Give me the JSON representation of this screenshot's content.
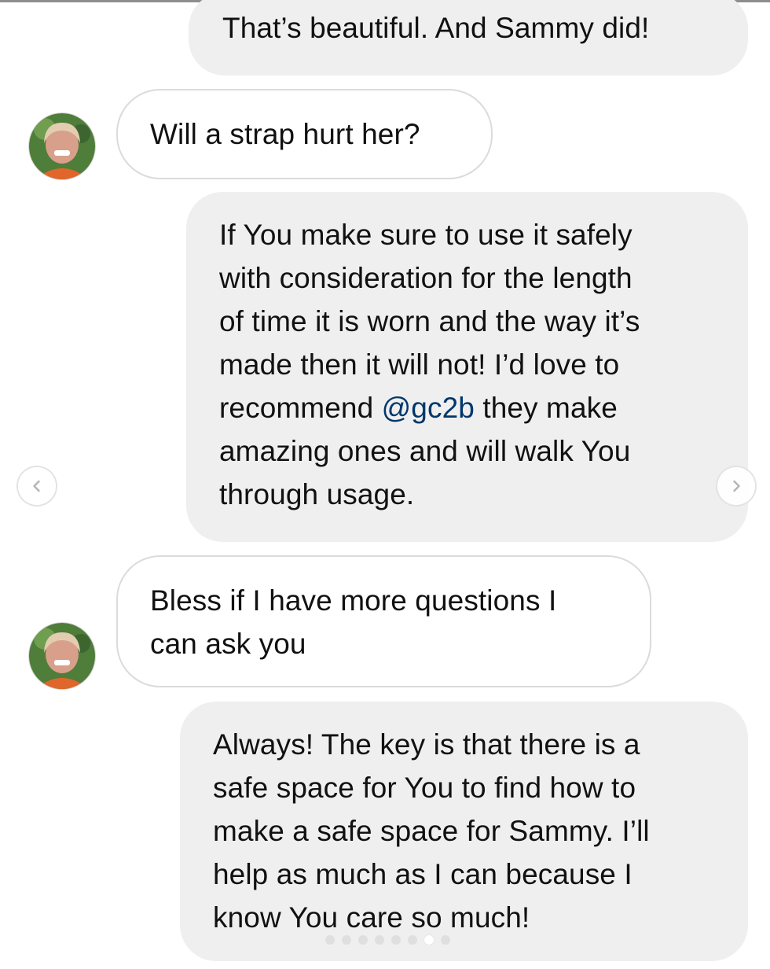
{
  "messages": [
    {
      "sender": "me",
      "text": "That’s beautiful. And Sammy did!"
    },
    {
      "sender": "them",
      "text": "Will a strap hurt her?"
    },
    {
      "sender": "me",
      "lines": [
        "If You make sure to use it safely",
        "with consideration for the length",
        "of time it is worn and the way it’s",
        "made then it will not! I’d love to"
      ],
      "line5_before": "recommend ",
      "mention": "@gc2b",
      "line5_after": " they make",
      "lines_after": [
        "amazing ones and will walk You",
        "through usage."
      ]
    },
    {
      "sender": "them",
      "lines": [
        "Bless if I have more questions I",
        "can ask you"
      ]
    },
    {
      "sender": "me",
      "lines": [
        "Always! The key is that there is a",
        "safe space for You to find how to",
        "make a safe space for Sammy. I’ll",
        "help as much as I can because I",
        "know You care so much!"
      ]
    }
  ],
  "colors": {
    "sent_bubble": "#efefef",
    "received_border": "#dbdbdb",
    "mention": "#00376b",
    "text": "#111111"
  },
  "avatar_icon": "user-avatar-photo",
  "navigation": {
    "prev_icon": "chevron-left-icon",
    "next_icon": "chevron-right-icon"
  },
  "carousel": {
    "total_slides": 8,
    "current_slide": 7
  }
}
